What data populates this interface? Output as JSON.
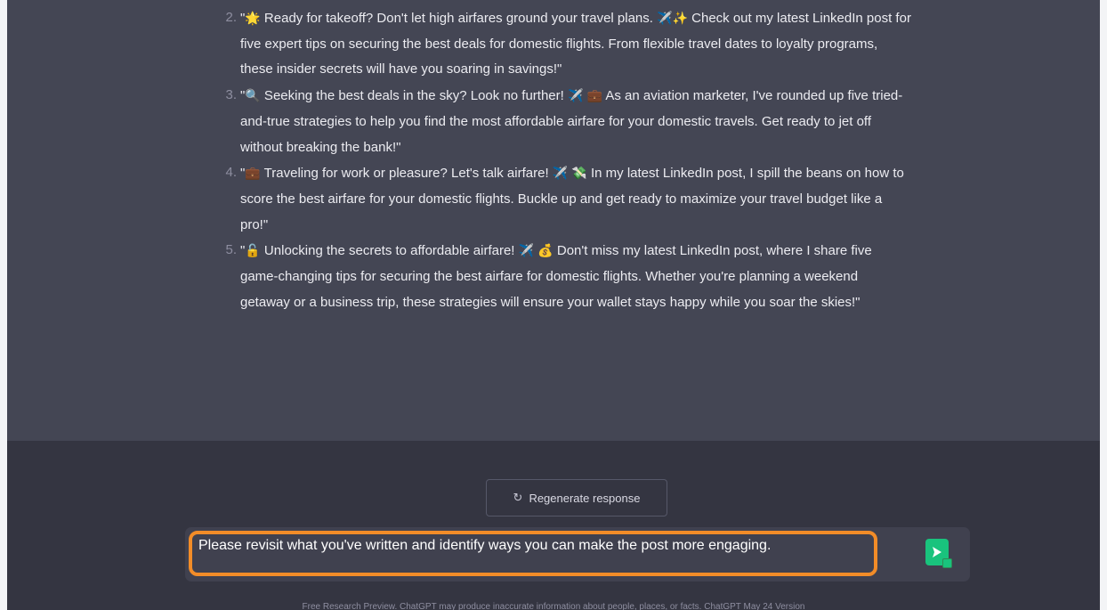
{
  "responses": [
    {
      "number": "2.",
      "segments": [
        {
          "text": "\""
        },
        {
          "emoji": "🌟",
          "name": "star-emoji"
        },
        {
          "text": " Ready for takeoff? Don't let high airfares ground your travel plans. "
        },
        {
          "emoji": "✈️",
          "name": "airplane-emoji"
        },
        {
          "emoji": "✨",
          "name": "sparkles-emoji"
        },
        {
          "text": " Check out my latest LinkedIn post for five expert tips on securing the best deals for domestic flights. From flexible travel dates to loyalty programs, these insider secrets will have you soaring in savings!\""
        }
      ]
    },
    {
      "number": "3.",
      "segments": [
        {
          "text": "\""
        },
        {
          "emoji": "🔍",
          "name": "magnifier-emoji"
        },
        {
          "text": " Seeking the best deals in the sky? Look no further! "
        },
        {
          "emoji": "✈️",
          "name": "airplane-emoji"
        },
        {
          "text": " "
        },
        {
          "emoji": "💼",
          "name": "briefcase-emoji"
        },
        {
          "text": " As an aviation marketer, I've rounded up five tried-and-true strategies to help you find the most affordable airfare for your domestic travels. Get ready to jet off without breaking the bank!\""
        }
      ]
    },
    {
      "number": "4.",
      "segments": [
        {
          "text": "\""
        },
        {
          "emoji": "💼",
          "name": "briefcase-emoji"
        },
        {
          "text": " Traveling for work or pleasure? Let's talk airfare! "
        },
        {
          "emoji": "✈️",
          "name": "airplane-emoji"
        },
        {
          "text": " "
        },
        {
          "emoji": "💸",
          "name": "money-wings-emoji"
        },
        {
          "text": " In my latest LinkedIn post, I spill the beans on how to score the best airfare for your domestic flights. Buckle up and get ready to maximize your travel budget like a pro!\""
        }
      ]
    },
    {
      "number": "5.",
      "segments": [
        {
          "text": "\""
        },
        {
          "emoji": "🔓",
          "name": "unlock-emoji"
        },
        {
          "text": " Unlocking the secrets to affordable airfare! "
        },
        {
          "emoji": "✈️",
          "name": "airplane-emoji"
        },
        {
          "text": " "
        },
        {
          "emoji": "💰",
          "name": "money-bag-emoji"
        },
        {
          "text": " Don't miss my latest LinkedIn post, where I share five game-changing tips for securing the best airfare for domestic flights. Whether you're planning a weekend getaway or a business trip, these strategies will ensure your wallet stays happy while you soar the skies!\""
        }
      ]
    }
  ],
  "regenerate": {
    "icon": "refresh-icon",
    "label": "Regenerate response"
  },
  "input": {
    "value": "Please revisit what you've written and identify ways you can make the post more engaging."
  },
  "send": {
    "icon": "send-arrow-icon"
  },
  "footer": {
    "text": "Free Research Preview. ChatGPT may produce inaccurate information about people, places, or facts. ChatGPT May 24 Version"
  },
  "colors": {
    "background": "#343541",
    "assistant_bg": "#444654",
    "highlight": "#f28c28",
    "send_button": "#19c37d"
  }
}
